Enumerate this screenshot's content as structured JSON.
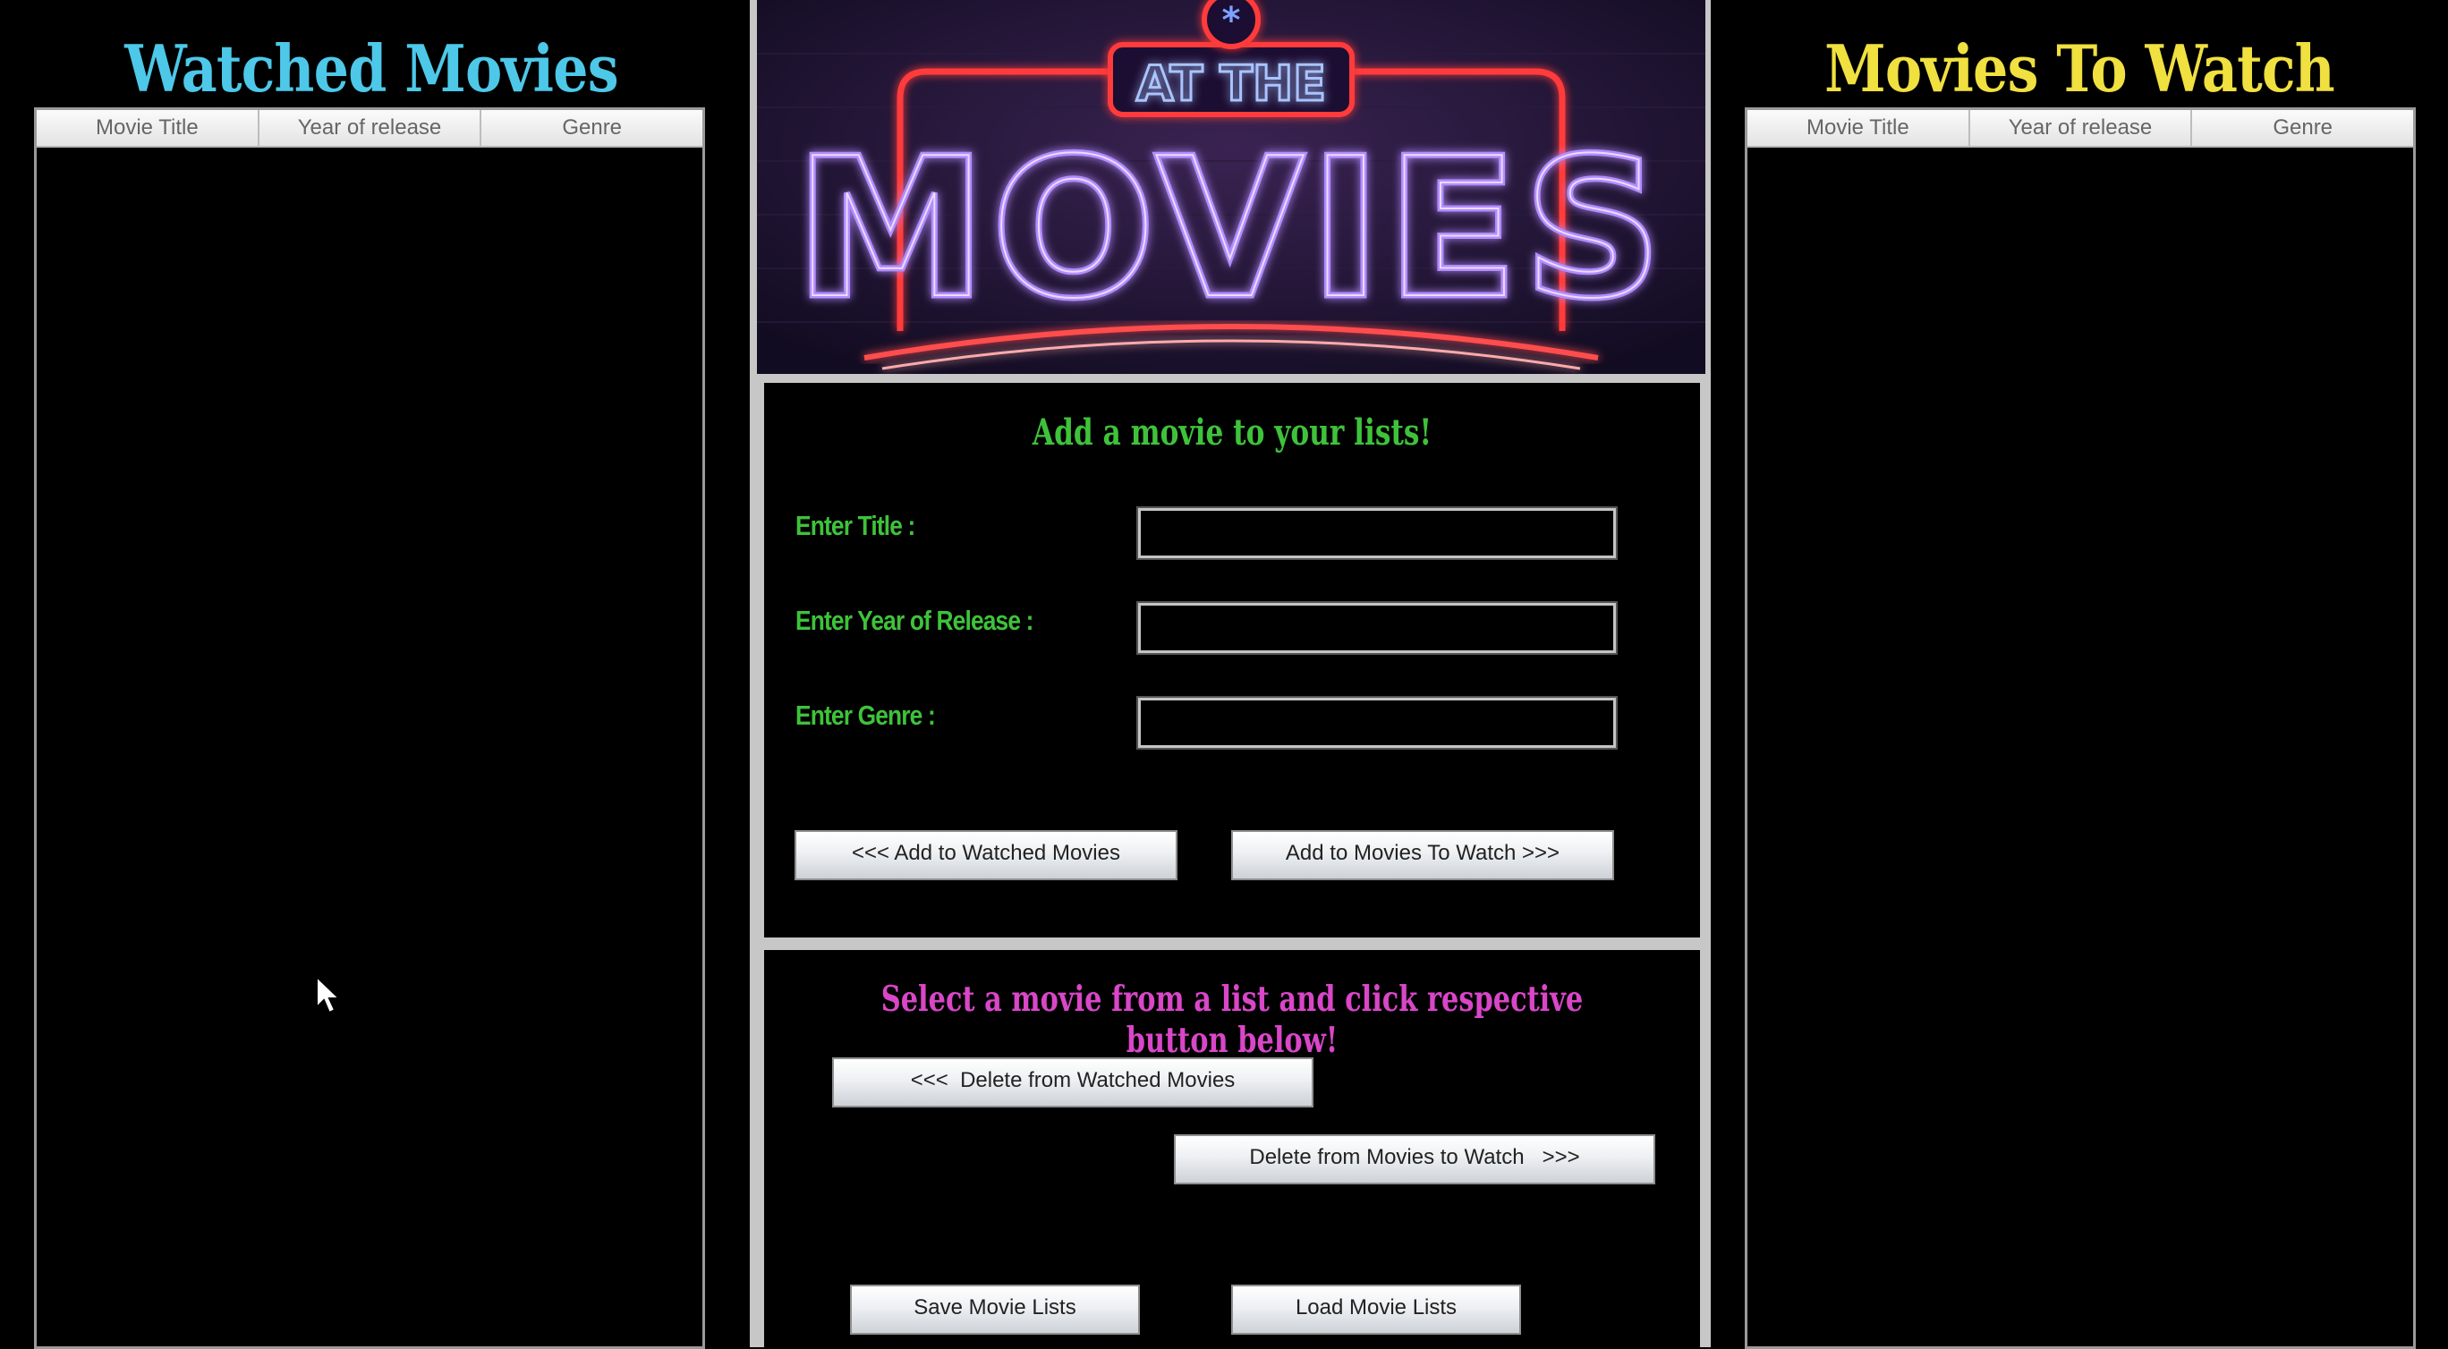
{
  "watched_panel": {
    "title": "Watched Movies",
    "title_color": "#4dc8e8",
    "columns": [
      "Movie Title",
      "Year of release",
      "Genre"
    ],
    "rows": []
  },
  "to_watch_panel": {
    "title": "Movies To Watch",
    "title_color": "#f0e040",
    "columns": [
      "Movie Title",
      "Year of release",
      "Genre"
    ],
    "rows": []
  },
  "banner": {
    "line1": "AT THE",
    "line2": "MOVIES"
  },
  "add_section": {
    "heading": "Add a movie to your lists!",
    "title_label": "Enter Title :",
    "year_label": "Enter Year of Release :",
    "genre_label": "Enter Genre :",
    "title_value": "",
    "year_value": "",
    "genre_value": "",
    "add_watched_button": "<<< Add to Watched Movies",
    "add_to_watch_button": "Add to Movies To Watch >>>"
  },
  "manage_section": {
    "heading": "Select a movie from a list and click respective button below!",
    "heading_color": "#d946c8",
    "delete_watched_button": "<<<  Delete from Watched Movies",
    "delete_to_watch_button": "Delete from Movies to Watch   >>>",
    "save_button": "Save Movie Lists",
    "load_button": "Load Movie Lists"
  },
  "colors": {
    "accent_green": "#3fc23b",
    "neon_pink": "#ff3c8a",
    "neon_purple": "#9b5cff"
  }
}
